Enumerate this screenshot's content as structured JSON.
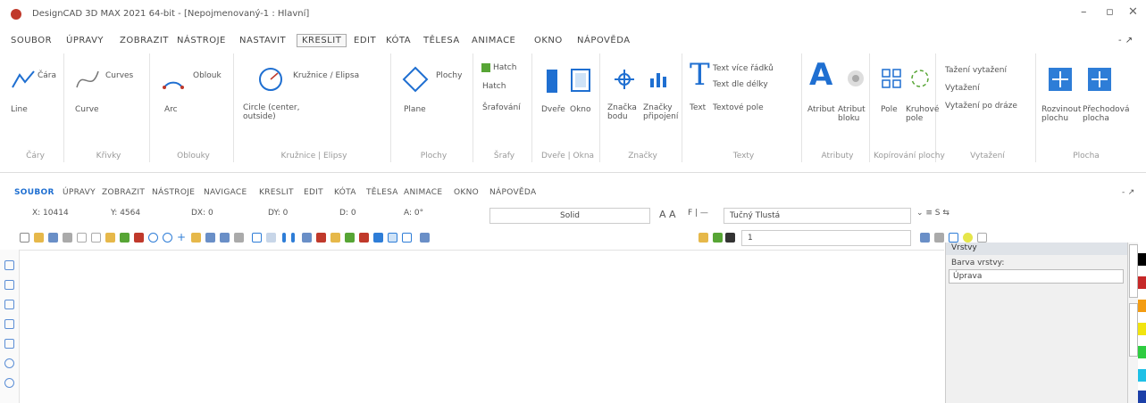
{
  "window": {
    "title": "DesignCAD 3D MAX 2021 64-bit - [Nepojmenovaný-1 : Hlavní]",
    "minimize": "–",
    "restore": "▫",
    "close": "✕"
  },
  "menu": {
    "items": [
      "SOUBOR",
      "ÚPRAVY",
      "ZOBRAZIT",
      "NÁSTROJE",
      "NASTAVIT",
      "KRESLIT",
      "EDIT",
      "KÓTA",
      "TĚLESA",
      "ANIMACE",
      "OKNO",
      "NÁPOVĚDA"
    ],
    "active_index": 5,
    "right_glyph": "- ↗"
  },
  "ribbon": {
    "groups": [
      {
        "label": "Čáry",
        "texts": [
          "Čára",
          "Line"
        ]
      },
      {
        "label": "Křivky",
        "texts": [
          "Curves",
          "Curve"
        ]
      },
      {
        "label": "Oblouky",
        "texts": [
          "Oblouk",
          "Arc"
        ]
      },
      {
        "label": "Kružnice | Elipsy",
        "texts": [
          "Kružnice / Elipsa",
          "Circle (center, outside)"
        ]
      },
      {
        "label": "Plochy",
        "texts": [
          "Plochy",
          "Plane"
        ]
      },
      {
        "label": "Šrafy",
        "texts": [
          "Hatch",
          "Hatch",
          "Šrafování"
        ]
      },
      {
        "label": "Dveře | Okna",
        "texts": [
          "Dveře",
          "Okno"
        ]
      },
      {
        "label": "Značky",
        "texts": [
          "Značka bodu",
          "Značky připojení"
        ]
      },
      {
        "label": "Texty",
        "texts": [
          "Text více řádků",
          "Text dle délky",
          "Text",
          "Textové pole"
        ]
      },
      {
        "label": "Atributy",
        "texts": [
          "Atribut",
          "Atribut bloku"
        ]
      },
      {
        "label": "Kopírování plochy",
        "texts": [
          "Pole",
          "Kruhové pole"
        ]
      },
      {
        "label": "Vytažení",
        "texts": [
          "Tažení vytažení",
          "Vytažení",
          "Vytažení po dráze"
        ]
      },
      {
        "label": "Plocha",
        "texts": [
          "Rozvinout plochu",
          "Přechodová plocha"
        ]
      }
    ]
  },
  "tabs": {
    "items": [
      "SOUBOR",
      "ÚPRAVY",
      "ZOBRAZIT",
      "NÁSTROJE",
      "NAVIGACE",
      "KRESLIT",
      "EDIT",
      "KÓTA",
      "TĚLESA",
      "ANIMACE",
      "OKNO",
      "NÁPOVĚDA"
    ],
    "right_glyph": "- ↗"
  },
  "props": {
    "x": "X: 10414",
    "y": "Y: 4564",
    "dx": "DX: 0",
    "dy": "DY: 0",
    "d": "D: 0",
    "a": "A: 0°",
    "line_style": "Solid",
    "font": "Tučný Tlustá",
    "line_width": "1"
  },
  "panel": {
    "title": "Vrstvy",
    "label": "Barva vrstvy:",
    "combo_value": "Úprava"
  },
  "colors": {
    "accent": "#2e7dd7",
    "icon_blue": "#1f6fd1",
    "green": "#57a535"
  }
}
